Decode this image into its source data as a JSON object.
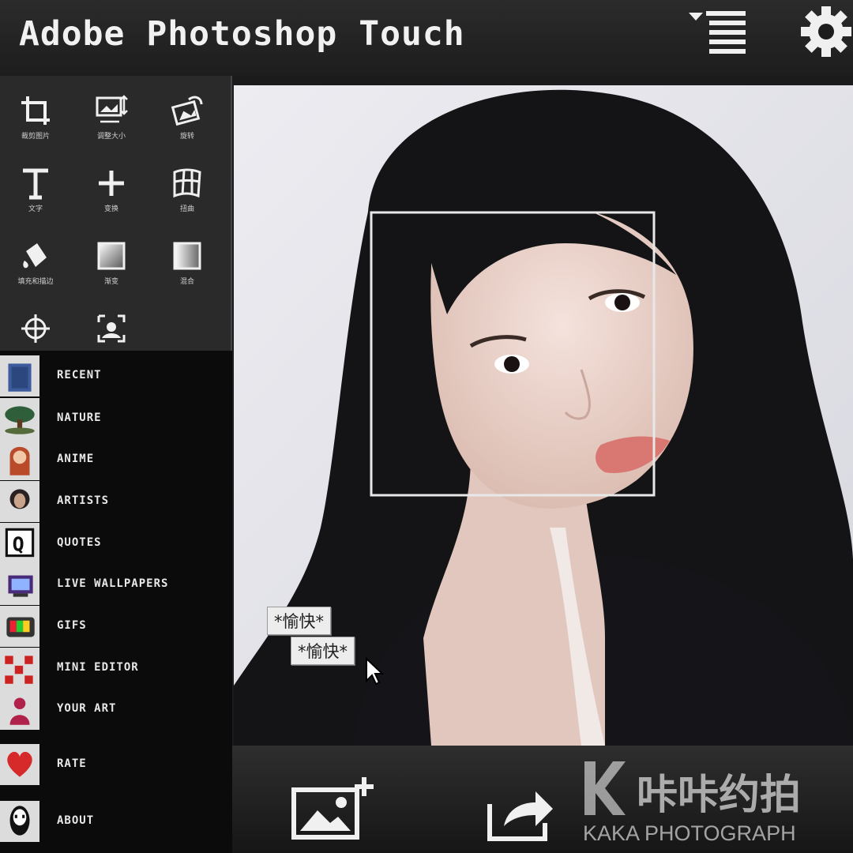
{
  "app": {
    "title": "Adobe Photoshop Touch"
  },
  "toolbar": {
    "menu_icon": "dropdown-list-icon",
    "settings_icon": "gear-icon"
  },
  "tools": [
    {
      "label": "裁剪图片",
      "icon": "crop-icon"
    },
    {
      "label": "调整大小",
      "icon": "resize-image-icon"
    },
    {
      "label": "旋转",
      "icon": "rotate-image-icon"
    },
    {
      "label": "文字",
      "icon": "text-icon"
    },
    {
      "label": "变换",
      "icon": "transform-plus-icon"
    },
    {
      "label": "扭曲",
      "icon": "warp-grid-icon"
    },
    {
      "label": "填充和描边",
      "icon": "paint-bucket-icon"
    },
    {
      "label": "渐变",
      "icon": "gradient-icon"
    },
    {
      "label": "混合",
      "icon": "blend-icon"
    },
    {
      "label": "",
      "icon": "target-icon"
    },
    {
      "label": "",
      "icon": "scan-image-icon"
    }
  ],
  "sidebar": {
    "items": [
      {
        "label": "RECENT",
        "icon": "recent-thumb"
      },
      {
        "label": "NATURE",
        "icon": "nature-thumb"
      },
      {
        "label": "ANIME",
        "icon": "anime-thumb"
      },
      {
        "label": "ARTISTS",
        "icon": "artists-thumb"
      },
      {
        "label": "QUOTES",
        "icon": "quotes-thumb"
      },
      {
        "label": "LIVE WALLPAPERS",
        "icon": "live-wallpapers-thumb"
      },
      {
        "label": "GIFS",
        "icon": "gifs-thumb"
      },
      {
        "label": "MINI EDITOR",
        "icon": "mini-editor-thumb"
      },
      {
        "label": "YOUR ART",
        "icon": "your-art-thumb"
      },
      {
        "label": "RATE",
        "icon": "heart-icon"
      },
      {
        "label": "ABOUT",
        "icon": "about-icon"
      }
    ]
  },
  "tooltips": [
    "*愉快*",
    "*愉快*"
  ],
  "bottombar": {
    "import_icon": "add-image-icon",
    "share_icon": "share-icon"
  },
  "watermark": {
    "brand": "咔咔约拍",
    "sub": "KAKA  PHOTOGRAPH"
  },
  "colors": {
    "bar": "#1d1d1d",
    "panel": "#2a2a2a",
    "list_bg": "#0b0b0b",
    "text": "#e8e8e8"
  }
}
